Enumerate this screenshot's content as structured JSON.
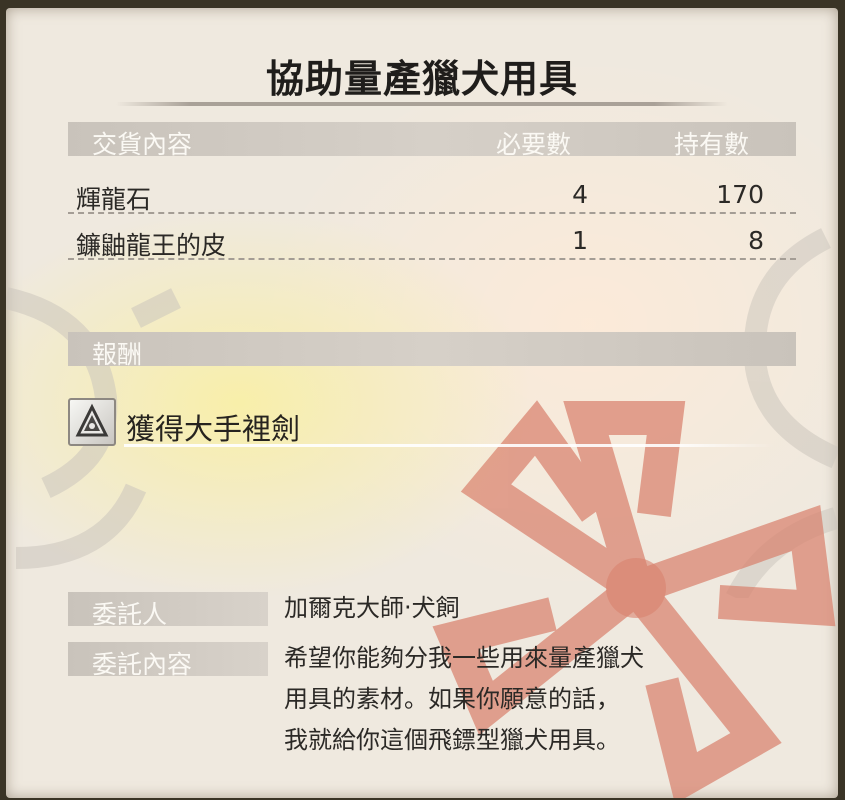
{
  "title": "協助量產獵犬用具",
  "requirements": {
    "headers": {
      "item": "交貨內容",
      "required": "必要數",
      "owned": "持有數"
    },
    "rows": [
      {
        "name": "輝龍石",
        "required": "4",
        "owned": "170"
      },
      {
        "name": "鐮鼬龍王的皮",
        "required": "1",
        "owned": "8"
      }
    ]
  },
  "reward": {
    "header": "報酬",
    "item_name": "獲得大手裡劍",
    "icon": "shuriken-icon"
  },
  "client": {
    "label": "委託人",
    "value": "加爾克大師‧犬飼"
  },
  "request": {
    "label": "委託內容",
    "lines": [
      "希望你能夠分我一些用來量產獵犬",
      "用具的素材。如果你願意的話，",
      "我就給你這個飛鏢型獵犬用具。"
    ]
  },
  "colors": {
    "band": "#cfc9c1",
    "emblem": "#d9826e",
    "parchment": "#efe9df"
  }
}
